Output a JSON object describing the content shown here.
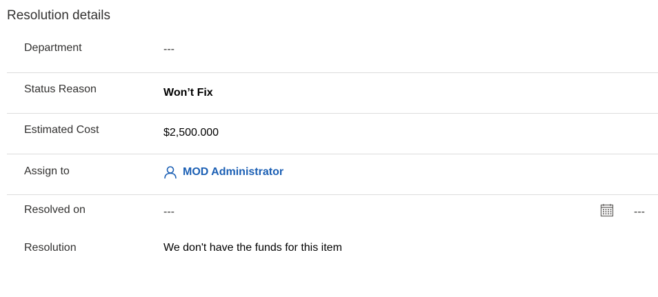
{
  "section": {
    "title": "Resolution details"
  },
  "fields": {
    "department": {
      "label": "Department",
      "value": "---"
    },
    "status_reason": {
      "label": "Status Reason",
      "value": "Won’t Fix"
    },
    "estimated_cost": {
      "label": "Estimated Cost",
      "value": "$2,500.000"
    },
    "assign_to": {
      "label": "Assign to",
      "value": "MOD Administrator",
      "icon": "person-icon"
    },
    "resolved_on": {
      "label": "Resolved on",
      "date_value": "---",
      "time_value": "---",
      "icon": "calendar-icon"
    },
    "resolution": {
      "label": "Resolution",
      "value": "We don't have the funds for this item"
    }
  },
  "colors": {
    "link": "#1b5fb4",
    "divider": "#dcdcdc",
    "label": "#323130"
  }
}
